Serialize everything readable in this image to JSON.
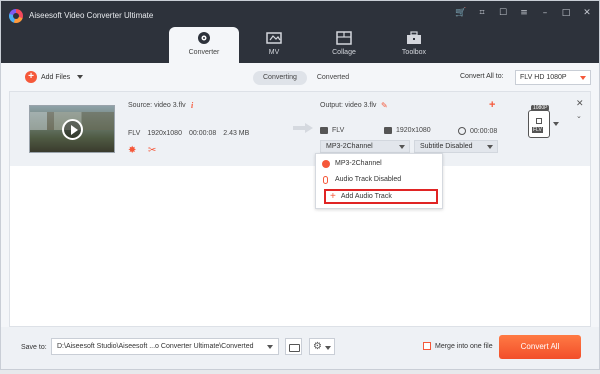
{
  "app": {
    "title": "Aiseesoft Video Converter Ultimate"
  },
  "window_controls": [
    "cart-icon",
    "key-icon",
    "chat-icon",
    "menu-icon",
    "minimize-icon",
    "maximize-icon",
    "close-icon"
  ],
  "tabs": [
    {
      "label": "Converter",
      "active": true,
      "icon": "converter-icon"
    },
    {
      "label": "MV",
      "active": false,
      "icon": "mv-icon"
    },
    {
      "label": "Collage",
      "active": false,
      "icon": "collage-icon"
    },
    {
      "label": "Toolbox",
      "active": false,
      "icon": "toolbox-icon"
    }
  ],
  "toolbar": {
    "add_files": "Add Files",
    "segments": [
      {
        "label": "Converting",
        "active": true
      },
      {
        "label": "Converted",
        "active": false
      }
    ],
    "convert_all_to_label": "Convert All to:",
    "convert_all_to_value": "FLV HD 1080P"
  },
  "file": {
    "source": "Source: video 3.flv",
    "format": "FLV",
    "resolution": "1920x1080",
    "duration": "00:00:08",
    "size": "2.43 MB",
    "output": "Output: video 3.flv",
    "out_format": "FLV",
    "out_resolution": "1920x1080",
    "out_duration": "00:00:08",
    "audio_track": "MP3-2Channel",
    "subtitle": "Subtitle Disabled",
    "badge_top": "1080P",
    "badge_label": "FLV"
  },
  "audio_dropdown": {
    "items": [
      {
        "label": "MP3-2Channel",
        "icon": "audio-icon"
      },
      {
        "label": "Audio Track Disabled",
        "icon": "mic-icon"
      },
      {
        "label": "Add Audio Track",
        "icon": "plus-icon",
        "highlighted": true
      }
    ]
  },
  "bottom": {
    "save_to_label": "Save to:",
    "save_path": "D:\\Aiseesoft Studio\\Aiseesoft ...o Converter Ultimate\\Converted",
    "merge_label": "Merge into one file",
    "convert_all_label": "Convert All"
  },
  "colors": {
    "accent": "#f5583a",
    "titlebar": "#2d323b",
    "highlight_border": "#e02424"
  }
}
